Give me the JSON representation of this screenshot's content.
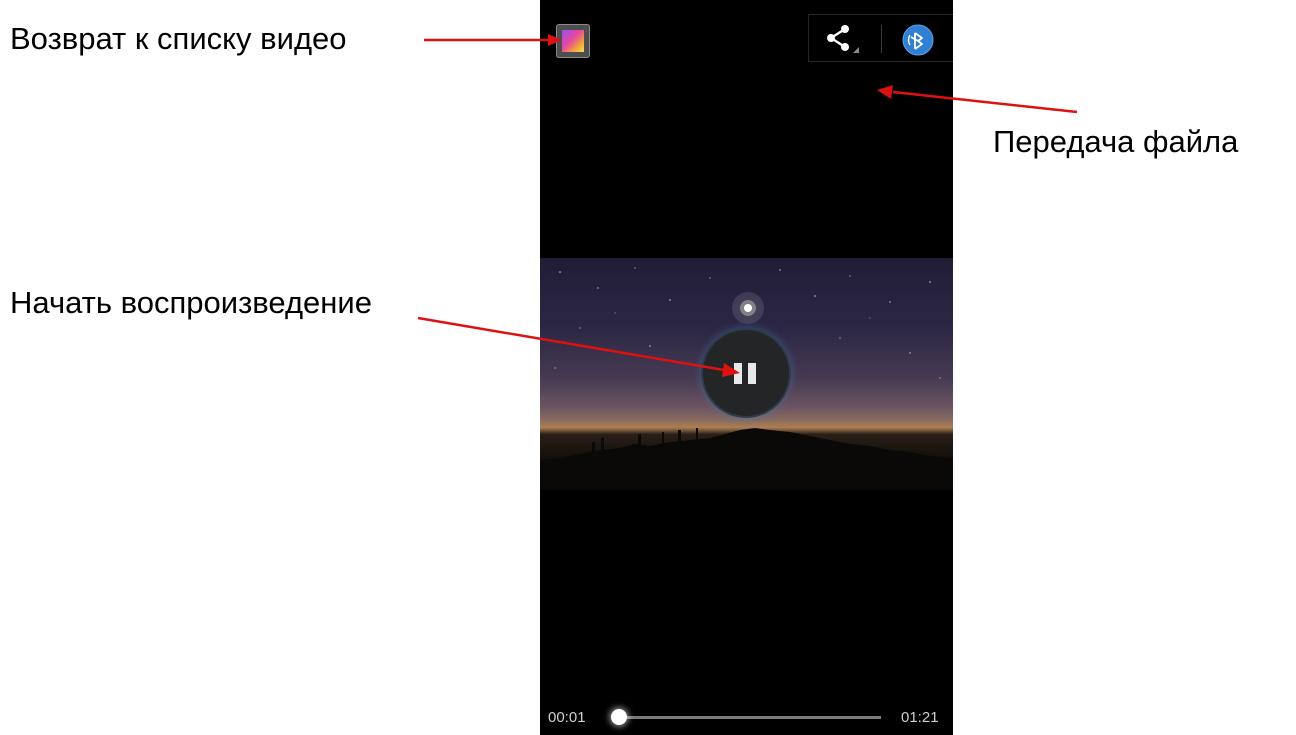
{
  "annotations": {
    "back_to_list": "Возврат к списку видео",
    "file_transfer": "Передача файла",
    "start_playback": "Начать воспроизведение"
  },
  "player": {
    "time_current": "00:01",
    "time_total": "01:21",
    "progress": 0.012
  },
  "icons": {
    "app_icon": "gallery-app-icon",
    "share": "share-icon",
    "bluetooth": "bluetooth-icon",
    "pause": "pause-icon"
  },
  "colors": {
    "arrow": "#dd1111",
    "player_background": "#000000",
    "bluetooth_blue": "#2f7fd3"
  }
}
